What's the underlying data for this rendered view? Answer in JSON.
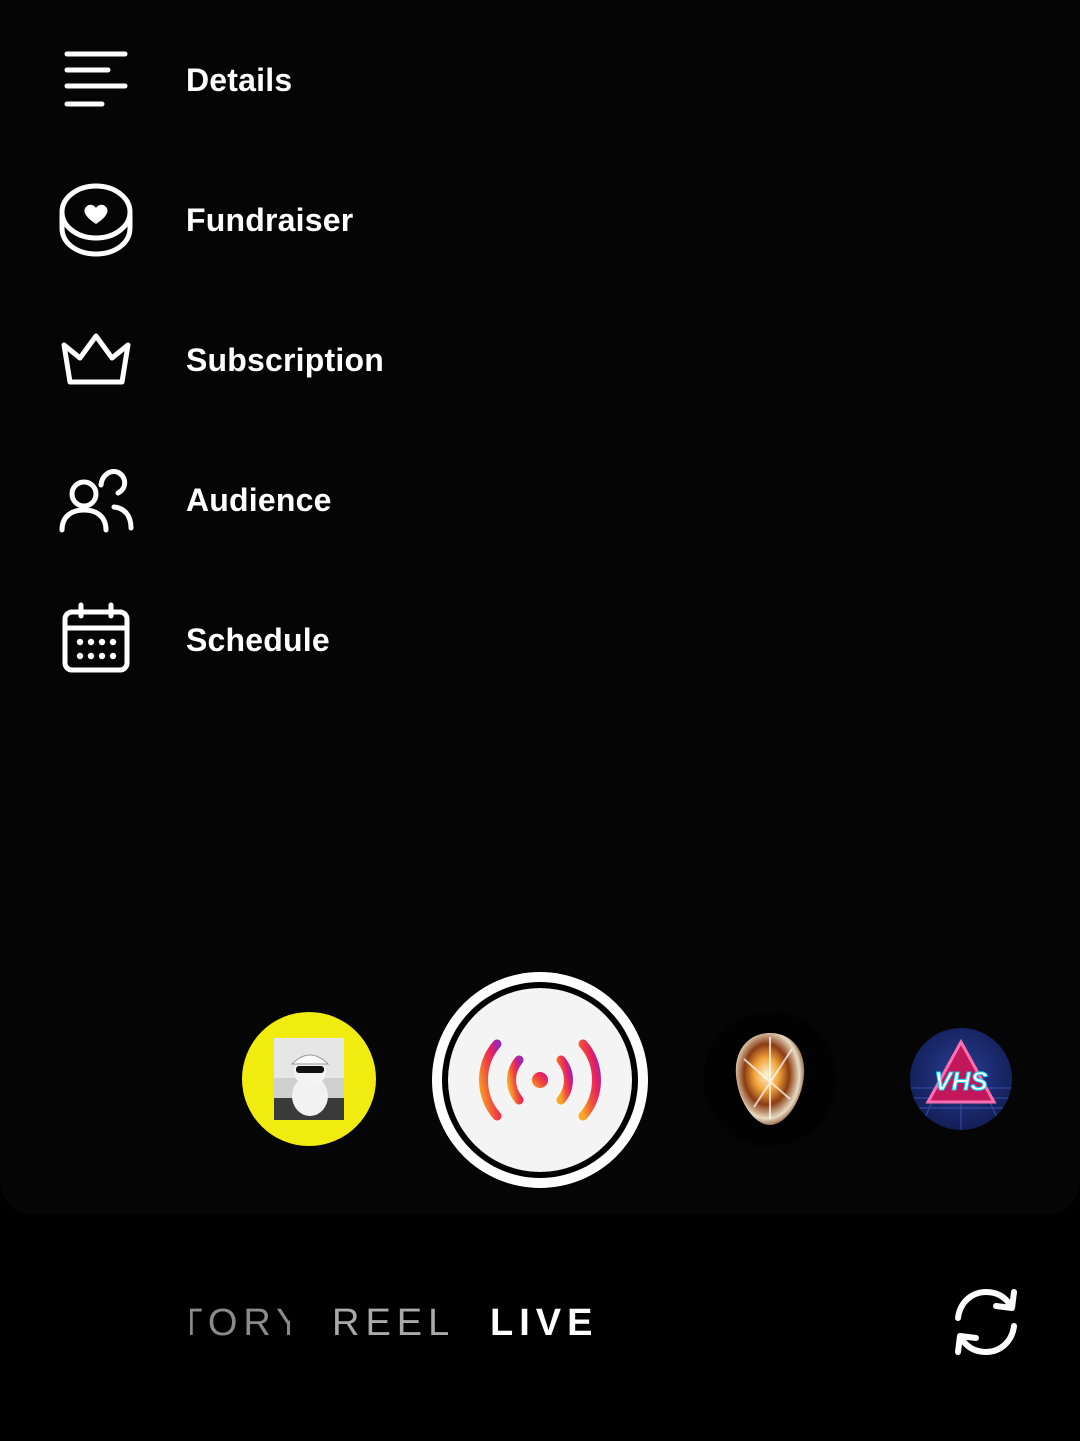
{
  "menu": {
    "items": [
      {
        "label": "Details",
        "icon": "details-lines-icon"
      },
      {
        "label": "Fundraiser",
        "icon": "fundraiser-heart-icon"
      },
      {
        "label": "Subscription",
        "icon": "crown-icon"
      },
      {
        "label": "Audience",
        "icon": "people-icon"
      },
      {
        "label": "Schedule",
        "icon": "calendar-icon"
      }
    ]
  },
  "capture": {
    "effects": [
      {
        "name": "cat-hat-effect",
        "background": "#f0ec0f"
      },
      {
        "name": "crystal-face-effect"
      },
      {
        "name": "vhs-effect",
        "text": "VHS"
      }
    ],
    "shutter_icon": "live-broadcast-icon",
    "shutter_gradient": [
      "#f9a825",
      "#e91e63",
      "#c2185b",
      "#7b1fa2"
    ]
  },
  "modes": {
    "story": "STORY",
    "reel": "REEL",
    "live": "LIVE",
    "selected": "LIVE"
  },
  "flip_camera_icon": "flip-camera-icon"
}
